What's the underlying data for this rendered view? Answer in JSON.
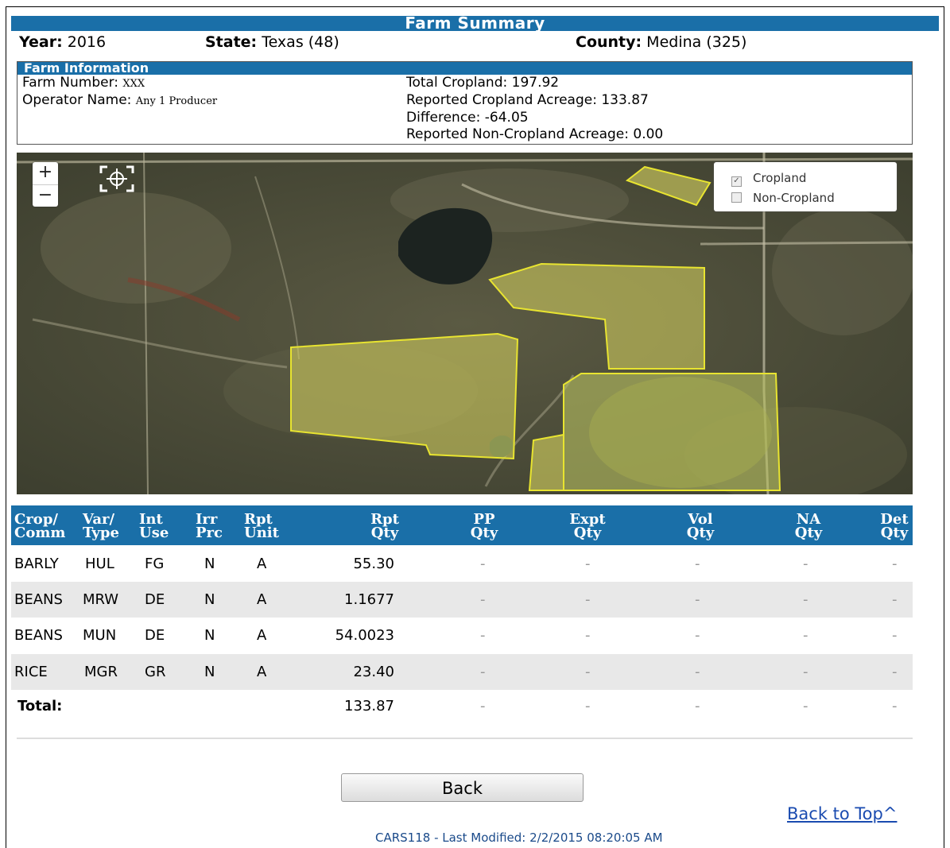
{
  "page": {
    "title": "Farm Summary",
    "year_label": "Year:",
    "year_value": "2016",
    "state_label": "State:",
    "state_value": "Texas (48)",
    "county_label": "County:",
    "county_value": "Medina (325)"
  },
  "farm_info": {
    "heading": "Farm Information",
    "farm_number_label": "Farm Number:",
    "farm_number_value": "XXX",
    "operator_label": "Operator Name:",
    "operator_value": "Any 1 Producer",
    "total_cropland": "Total Cropland: 197.92",
    "reported_cropland": "Reported Cropland Acreage: 133.87",
    "difference": "Difference: -64.05",
    "reported_noncropland": "Reported Non-Cropland Acreage: 0.00"
  },
  "map": {
    "zoom_in": "+",
    "zoom_out": "−",
    "legend": [
      {
        "label": "Cropland",
        "checked": true
      },
      {
        "label": "Non-Cropland",
        "checked": false
      }
    ],
    "colors": {
      "cropland_fill": "#d8d560",
      "cropland_stroke": "#e8e430"
    }
  },
  "table": {
    "headers": [
      [
        "Crop/",
        "Comm"
      ],
      [
        "Var/",
        "Type"
      ],
      [
        "Int",
        "Use"
      ],
      [
        "Irr",
        "Prc"
      ],
      [
        "Rpt",
        "Unit"
      ],
      [
        "Rpt",
        "Qty"
      ],
      [
        "PP",
        "Qty"
      ],
      [
        "Expt",
        "Qty"
      ],
      [
        "Vol",
        "Qty"
      ],
      [
        "NA",
        "Qty"
      ],
      [
        "Det",
        "Qty"
      ]
    ],
    "rows": [
      [
        "BARLY",
        "HUL",
        "FG",
        "N",
        "A",
        "55.30",
        "-",
        "-",
        "-",
        "-",
        "-"
      ],
      [
        "BEANS",
        "MRW",
        "DE",
        "N",
        "A",
        "1.1677",
        "-",
        "-",
        "-",
        "-",
        "-"
      ],
      [
        "BEANS",
        "MUN",
        "DE",
        "N",
        "A",
        "54.0023",
        "-",
        "-",
        "-",
        "-",
        "-"
      ],
      [
        "RICE",
        "MGR",
        "GR",
        "N",
        "A",
        "23.40",
        "-",
        "-",
        "-",
        "-",
        "-"
      ]
    ],
    "total": [
      "Total:",
      "133.87",
      "-",
      "-",
      "-",
      "-",
      "-"
    ]
  },
  "actions": {
    "back": "Back",
    "back_to_top": "Back to Top^"
  },
  "footer": {
    "text": "CARS118 -  Last Modified: 2/2/2015 08:20:05 AM"
  },
  "colors": {
    "header_blue": "#1a6fa8",
    "link_blue": "#1a4bb0"
  }
}
